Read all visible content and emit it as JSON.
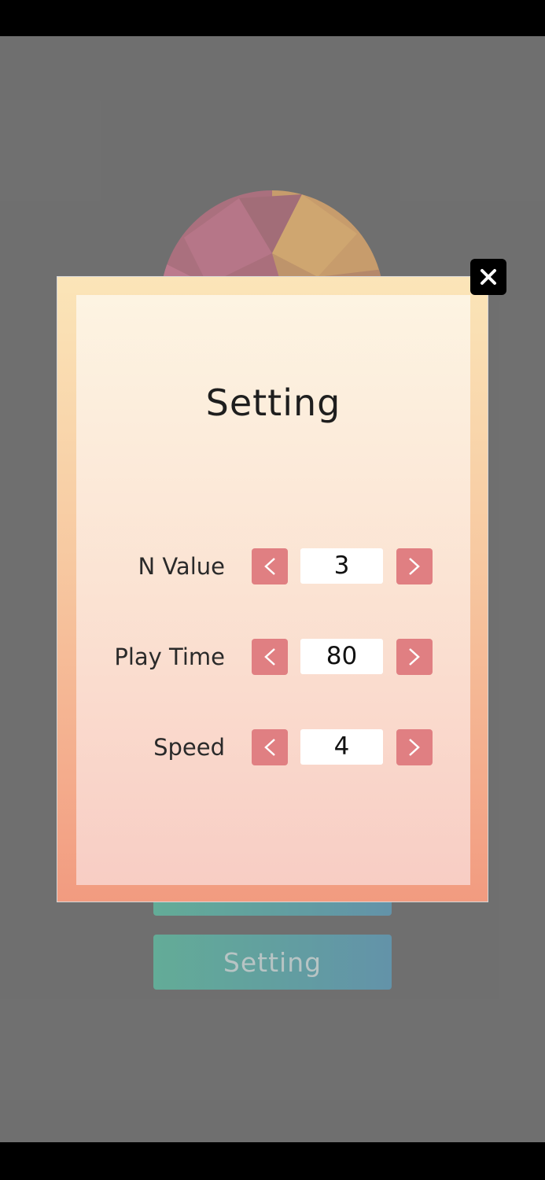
{
  "background": {
    "menu_buttons": [
      {
        "label": ""
      },
      {
        "label": "Setting"
      }
    ]
  },
  "modal": {
    "title": "Setting",
    "rows": [
      {
        "label": "N Value",
        "value": "3",
        "decrease_icon": "chevron-left-icon",
        "increase_icon": "chevron-right-icon"
      },
      {
        "label": "Play Time",
        "value": "80",
        "decrease_icon": "chevron-left-icon",
        "increase_icon": "chevron-right-icon"
      },
      {
        "label": "Speed",
        "value": "4",
        "decrease_icon": "chevron-left-icon",
        "increase_icon": "chevron-right-icon"
      }
    ],
    "close_icon": "close-icon"
  },
  "colors": {
    "arrow_button": "#e07f82",
    "menu_gradient_start": "#0b7d5d",
    "menu_gradient_end": "#0b5679",
    "modal_border_top": "#fbe5b8",
    "modal_border_bottom": "#f29b80"
  }
}
